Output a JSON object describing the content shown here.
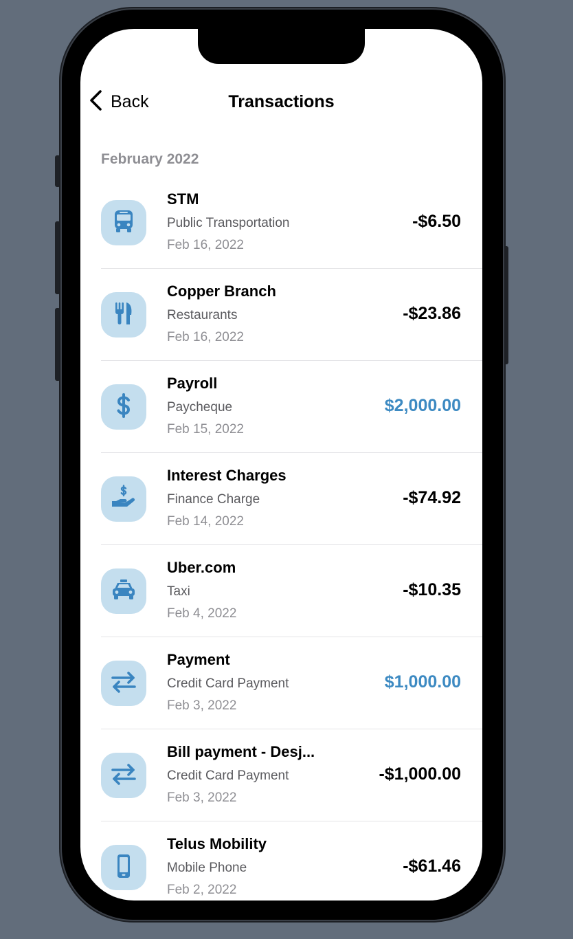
{
  "nav": {
    "back_label": "Back",
    "title": "Transactions"
  },
  "section": {
    "header": "February 2022"
  },
  "colors": {
    "accent": "#3d8ac2",
    "icon_tile_bg": "#c4deee",
    "icon_fg": "#3a85c0",
    "secondary_text": "#8e8e93"
  },
  "transactions": [
    {
      "merchant": "STM",
      "category": "Public Transportation",
      "date": "Feb 16, 2022",
      "amount": "-$6.50",
      "type": "debit",
      "icon": "bus-icon"
    },
    {
      "merchant": "Copper Branch",
      "category": "Restaurants",
      "date": "Feb 16, 2022",
      "amount": "-$23.86",
      "type": "debit",
      "icon": "fork-knife-icon"
    },
    {
      "merchant": "Payroll",
      "category": "Paycheque",
      "date": "Feb 15, 2022",
      "amount": "$2,000.00",
      "type": "credit",
      "icon": "dollar-icon"
    },
    {
      "merchant": "Interest Charges",
      "category": "Finance Charge",
      "date": "Feb 14, 2022",
      "amount": "-$74.92",
      "type": "debit",
      "icon": "hand-dollar-icon"
    },
    {
      "merchant": "Uber.com",
      "category": "Taxi",
      "date": "Feb 4, 2022",
      "amount": "-$10.35",
      "type": "debit",
      "icon": "taxi-icon"
    },
    {
      "merchant": "Payment",
      "category": "Credit Card Payment",
      "date": "Feb 3, 2022",
      "amount": "$1,000.00",
      "type": "credit",
      "icon": "transfer-arrows-icon"
    },
    {
      "merchant": "Bill payment - Desj...",
      "category": "Credit Card Payment",
      "date": "Feb 3, 2022",
      "amount": "-$1,000.00",
      "type": "debit",
      "icon": "transfer-arrows-icon"
    },
    {
      "merchant": "Telus Mobility",
      "category": "Mobile Phone",
      "date": "Feb 2, 2022",
      "amount": "-$61.46",
      "type": "debit",
      "icon": "mobile-phone-icon"
    }
  ]
}
